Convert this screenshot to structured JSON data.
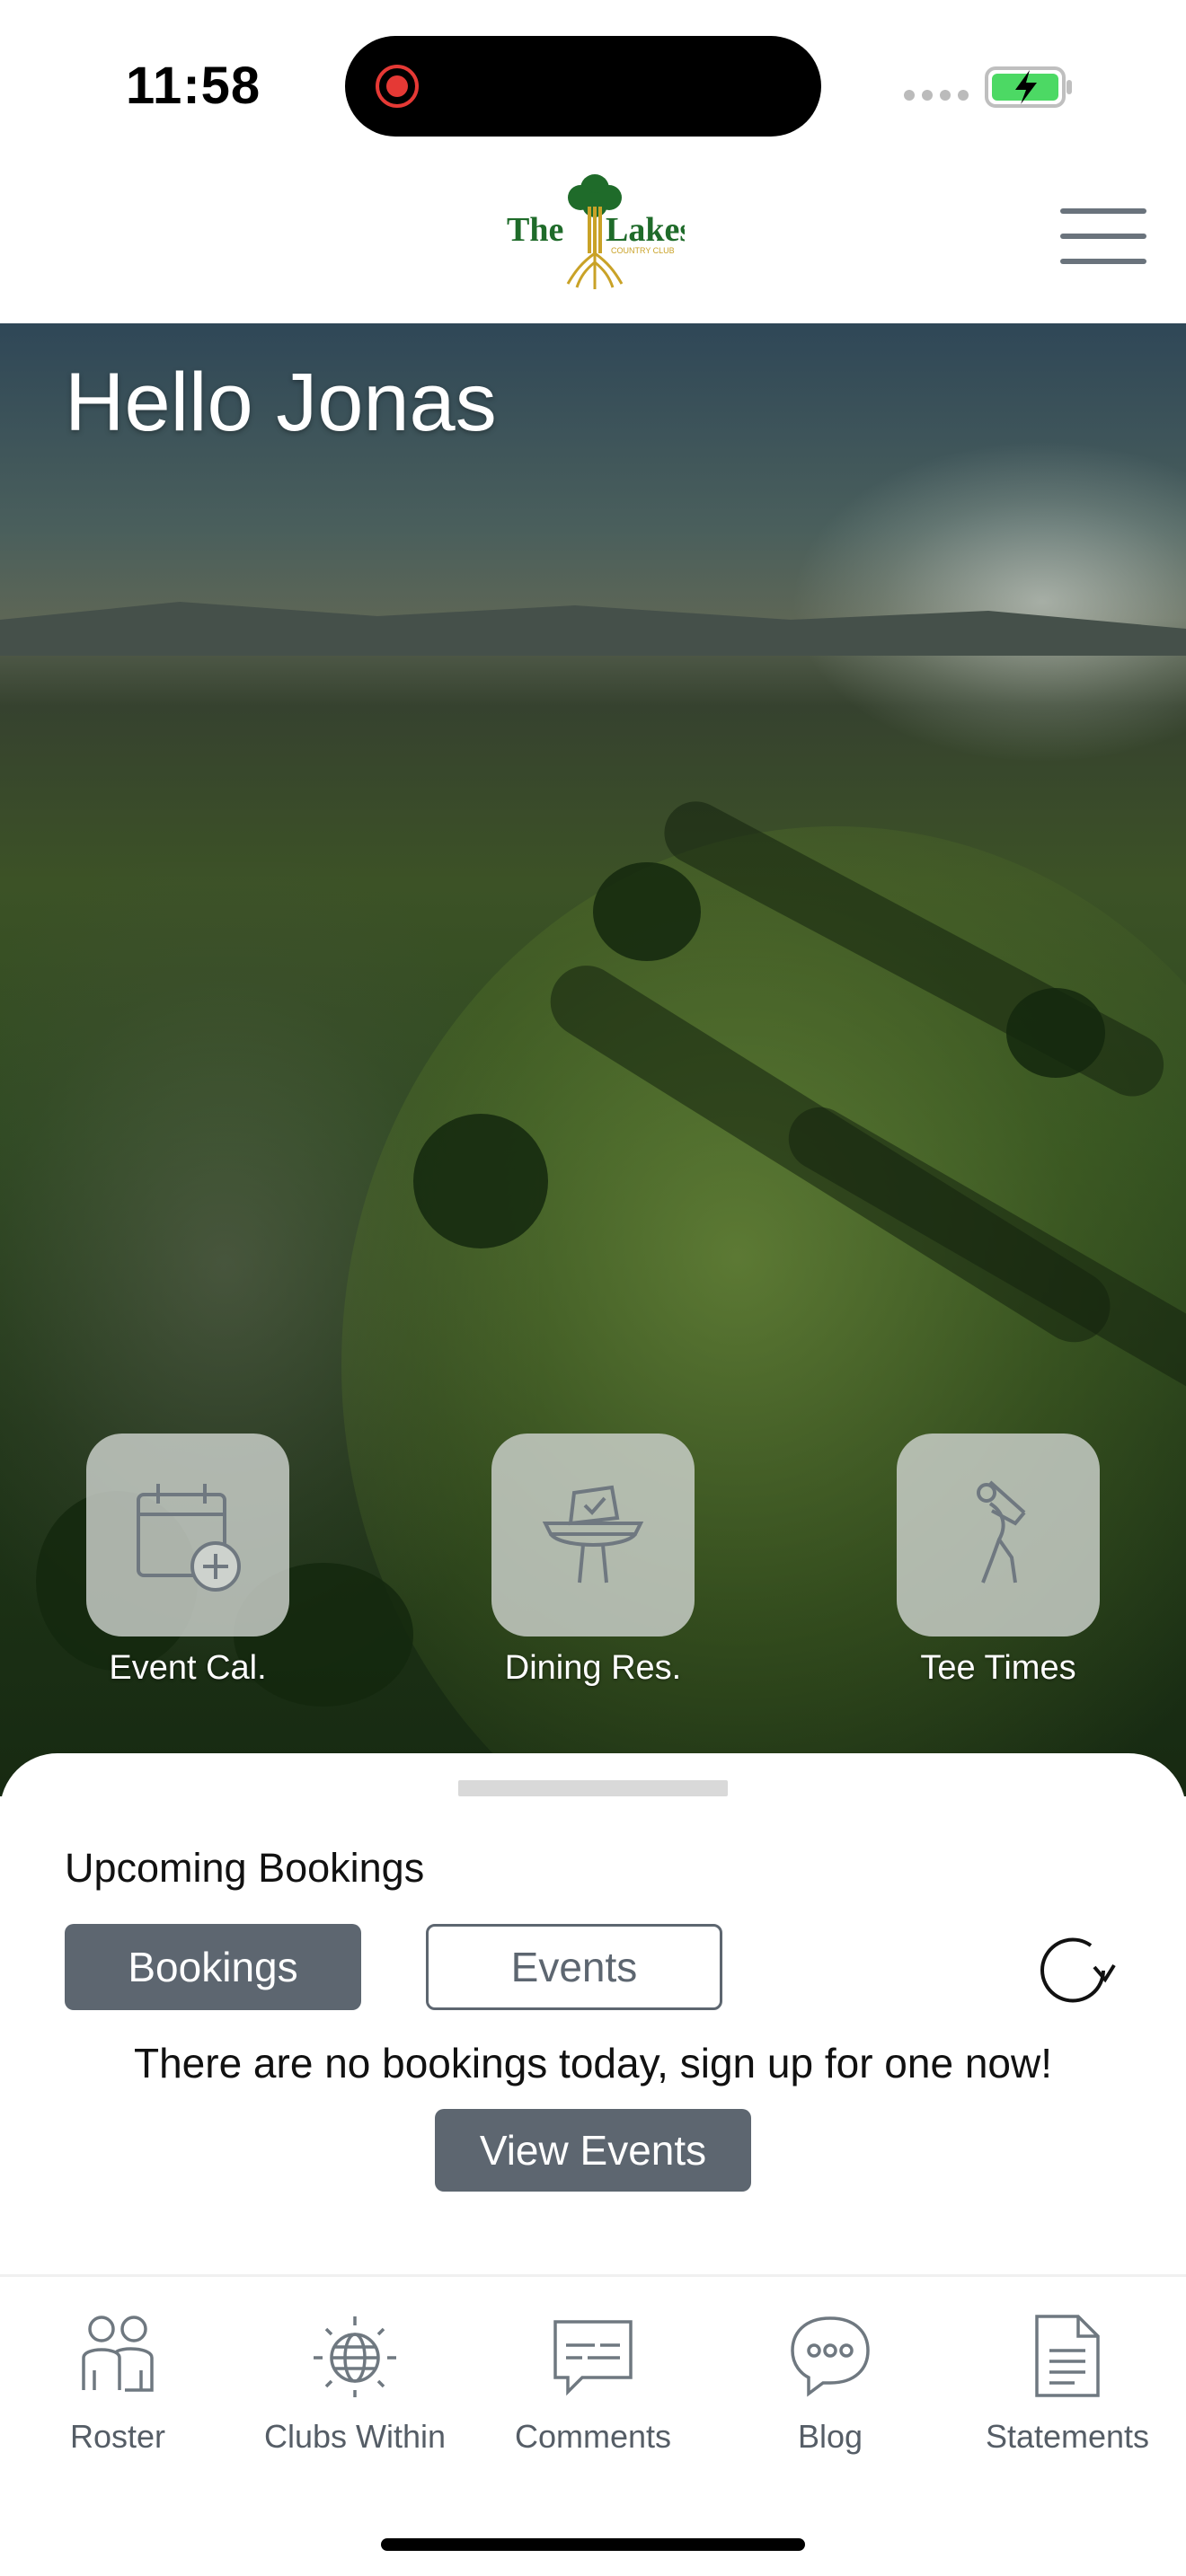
{
  "status_bar": {
    "time": "11:58",
    "recording_icon": "screen-recording-icon",
    "signal_icon": "cellular-signal-icon",
    "battery_icon": "battery-charging-icon",
    "battery_color": "#4cd964"
  },
  "header": {
    "logo_text_the": "The",
    "logo_text_lakes": "Lakes",
    "logo_subtitle": "COUNTRY CLUB",
    "menu_icon": "hamburger-menu-icon",
    "brand_green": "#1f6b2a",
    "brand_gold": "#c9a227"
  },
  "hero": {
    "greeting": "Hello Jonas",
    "quick_actions": [
      {
        "label": "Event Cal.",
        "icon": "calendar-add-icon"
      },
      {
        "label": "Dining Res.",
        "icon": "dining-table-reservation-icon"
      },
      {
        "label": "Tee Times",
        "icon": "golfer-icon"
      }
    ]
  },
  "bookings": {
    "title": "Upcoming Bookings",
    "tabs": [
      {
        "label": "Bookings",
        "active": true
      },
      {
        "label": "Events",
        "active": false
      }
    ],
    "refresh_icon": "refresh-icon",
    "empty_message": "There are no bookings today, sign up for one now!",
    "view_events_label": "View Events",
    "accent_color": "#5d6670"
  },
  "bottom_nav": {
    "items": [
      {
        "label": "Roster",
        "icon": "people-icon"
      },
      {
        "label": "Clubs Within",
        "icon": "globe-icon"
      },
      {
        "label": "Comments",
        "icon": "comment-icon"
      },
      {
        "label": "Blog",
        "icon": "chat-bubble-icon"
      },
      {
        "label": "Statements",
        "icon": "document-icon"
      }
    ]
  }
}
